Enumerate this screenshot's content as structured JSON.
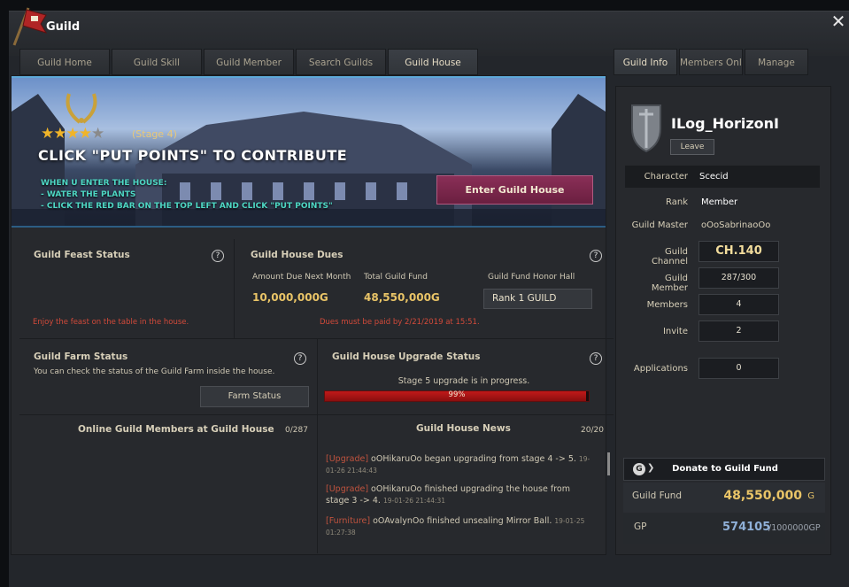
{
  "window": {
    "title": "Guild"
  },
  "tabs_left": [
    "Guild Home",
    "Guild Skill",
    "Guild Member",
    "Search Guilds",
    "Guild House"
  ],
  "tabs_right": [
    "Guild Info",
    "Members Online",
    "Manage"
  ],
  "hero": {
    "stage": "(Stage 4)",
    "stars_filled": 4,
    "stars_total": 5,
    "title": "CLICK \"PUT POINTS\" TO CONTRIBUTE",
    "notes": [
      "WHEN U ENTER THE HOUSE:",
      "- WATER THE PLANTS",
      "- CLICK THE RED BAR ON THE TOP LEFT AND CLICK \"PUT POINTS\""
    ],
    "enter_button": "Enter Guild House"
  },
  "feast": {
    "title": "Guild Feast Status",
    "note": "Enjoy the feast on the table in the house."
  },
  "dues": {
    "title": "Guild House Dues",
    "amount_label": "Amount Due Next Month",
    "amount_value": "10,000,000G",
    "fund_label": "Total Guild Fund",
    "fund_value": "48,550,000G",
    "honor_label": "Guild Fund Honor Hall",
    "honor_value": "Rank 1 GUILD",
    "note": "Dues must be paid by 2/21/2019 at 15:51."
  },
  "farm": {
    "title": "Guild Farm Status",
    "desc": "You can check the status of the Guild Farm inside the house.",
    "button": "Farm Status"
  },
  "upgrade": {
    "title": "Guild House Upgrade Status",
    "status": "Stage 5 upgrade is in progress.",
    "progress_text": "99%",
    "progress": 0.99
  },
  "online": {
    "title": "Online Guild Members at Guild House",
    "count": "0/287"
  },
  "news": {
    "title": "Guild House News",
    "count": "20/20",
    "items": [
      {
        "tag": "[Upgrade]",
        "text": " oOHikaruOo began upgrading from stage 4 -> 5. ",
        "time": "19-01-26 21:44:43"
      },
      {
        "tag": "[Upgrade]",
        "text": " oOHikaruOo finished upgrading the house from stage 3 -> 4. ",
        "time": "19-01-26 21:44:31"
      },
      {
        "tag": "[Furniture]",
        "text": " oOAvalynOo finished unsealing Mirror Ball. ",
        "time": "19-01-25 01:27:38"
      }
    ]
  },
  "info": {
    "guild_name": "ILog_HorizonI",
    "leave": "Leave",
    "character_label": "Character",
    "character_value": "Scecid",
    "rank_label": "Rank",
    "rank_value": "Member",
    "master_label": "Guild Master",
    "master_value": "oOoSabrinaoOo",
    "channel_label": "Guild Channel",
    "channel_value": "CH.140",
    "member_label": "Guild Member",
    "member_value": "287/300",
    "members_label": "Members",
    "members_value": "4",
    "invite_label": "Invite",
    "invite_value": "2",
    "applications_label": "Applications",
    "applications_value": "0",
    "donate_label": "Donate to Guild Fund",
    "donate_icon": "G",
    "fund_label": "Guild Fund",
    "fund_value": "48,550,000",
    "fund_unit": "G",
    "gp_label": "GP",
    "gp_value": "574105",
    "gp_max": "/1000000GP"
  },
  "colors": {
    "accent_red": "#c21919",
    "gold": "#e9c467",
    "teal_note": "#4ed7c4",
    "enter_button": "#7a2548"
  }
}
